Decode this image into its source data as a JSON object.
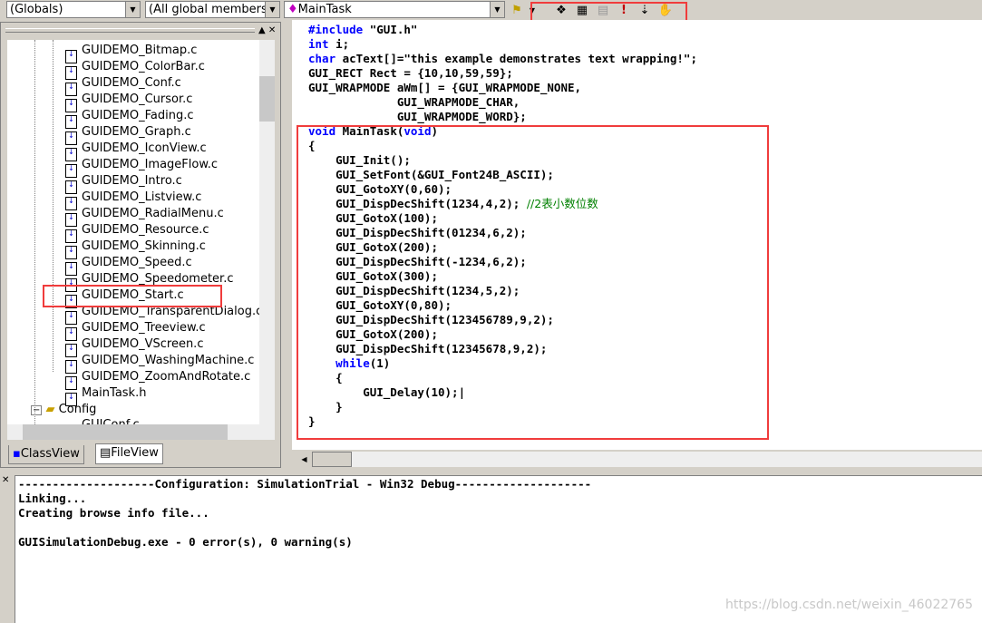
{
  "toolbar": {
    "scope": "(Globals)",
    "members": "(All global members",
    "function": "MainTask",
    "icons": [
      "wizard-icon",
      "bookmark-icon",
      "calendar-icon",
      "disabled-build-icon",
      "exclamation-icon",
      "sort-icon",
      "hand-icon"
    ]
  },
  "tree": {
    "items": [
      "GUIDEMO_Bitmap.c",
      "GUIDEMO_ColorBar.c",
      "GUIDEMO_Conf.c",
      "GUIDEMO_Cursor.c",
      "GUIDEMO_Fading.c",
      "GUIDEMO_Graph.c",
      "GUIDEMO_IconView.c",
      "GUIDEMO_ImageFlow.c",
      "GUIDEMO_Intro.c",
      "GUIDEMO_Listview.c",
      "GUIDEMO_RadialMenu.c",
      "GUIDEMO_Resource.c",
      "GUIDEMO_Skinning.c",
      "GUIDEMO_Speed.c",
      "GUIDEMO_Speedometer.c",
      "GUIDEMO_Start.c",
      "GUIDEMO_TransparentDialog.c",
      "GUIDEMO_Treeview.c",
      "GUIDEMO_VScreen.c",
      "GUIDEMO_WashingMachine.c",
      "GUIDEMO_ZoomAndRotate.c",
      "MainTask.h"
    ],
    "folder": "Config",
    "partial_item": "GUIConf.c"
  },
  "tabs": {
    "classview": "ClassView",
    "fileview": "FileView"
  },
  "code": [
    [
      [
        "#include",
        "kw"
      ],
      [
        " \"GUI.h\"",
        ""
      ]
    ],
    [
      [
        "int",
        "kw"
      ],
      [
        " i;",
        ""
      ]
    ],
    [
      [
        "char",
        "kw"
      ],
      [
        " acText[]=\"this example demonstrates text wrapping!\";",
        ""
      ]
    ],
    [
      [
        "GUI_RECT Rect = {10,10,59,59};",
        ""
      ]
    ],
    [
      [
        "GUI_WRAPMODE aWm[] = {GUI_WRAPMODE_NONE,",
        ""
      ]
    ],
    [
      [
        "             GUI_WRAPMODE_CHAR,",
        ""
      ]
    ],
    [
      [
        "             GUI_WRAPMODE_WORD};",
        ""
      ]
    ],
    [
      [
        "void",
        "kw"
      ],
      [
        " MainTask(",
        ""
      ],
      [
        "void",
        "kw"
      ],
      [
        ")",
        ""
      ]
    ],
    [
      [
        "{",
        ""
      ]
    ],
    [
      [
        "    GUI_Init();",
        ""
      ]
    ],
    [
      [
        "    GUI_SetFont(&GUI_Font24B_ASCII);",
        ""
      ]
    ],
    [
      [
        "    GUI_GotoXY(0,60);",
        ""
      ]
    ],
    [
      [
        "    GUI_DispDecShift(1234,4,2); ",
        ""
      ],
      [
        "//2表小数位数",
        "cm"
      ]
    ],
    [
      [
        "    GUI_GotoX(100);",
        ""
      ]
    ],
    [
      [
        "    GUI_DispDecShift(01234,6,2);",
        ""
      ]
    ],
    [
      [
        "    GUI_GotoX(200);",
        ""
      ]
    ],
    [
      [
        "    GUI_DispDecShift(-1234,6,2);",
        ""
      ]
    ],
    [
      [
        "    GUI_GotoX(300);",
        ""
      ]
    ],
    [
      [
        "    GUI_DispDecShift(1234,5,2);",
        ""
      ]
    ],
    [
      [
        "    GUI_GotoXY(0,80);",
        ""
      ]
    ],
    [
      [
        "    GUI_DispDecShift(123456789,9,2);",
        ""
      ]
    ],
    [
      [
        "    GUI_GotoX(200);",
        ""
      ]
    ],
    [
      [
        "    GUI_DispDecShift(12345678,9,2);",
        ""
      ]
    ],
    [
      [
        "    ",
        ""
      ],
      [
        "while",
        "kw"
      ],
      [
        "(1)",
        ""
      ]
    ],
    [
      [
        "    {",
        ""
      ]
    ],
    [
      [
        "        GUI_Delay(10);|",
        ""
      ]
    ],
    [
      [
        "    }",
        ""
      ]
    ],
    [
      [
        "}",
        ""
      ]
    ]
  ],
  "output": [
    "--------------------Configuration: SimulationTrial - Win32 Debug--------------------",
    "Linking...",
    "Creating browse info file...",
    "",
    "GUISimulationDebug.exe - 0 error(s), 0 warning(s)"
  ],
  "watermark": "https://blog.csdn.net/weixin_46022765",
  "colors": {
    "highlight": "#f03c3c",
    "keyword": "#0000ff",
    "comment": "#008000"
  }
}
